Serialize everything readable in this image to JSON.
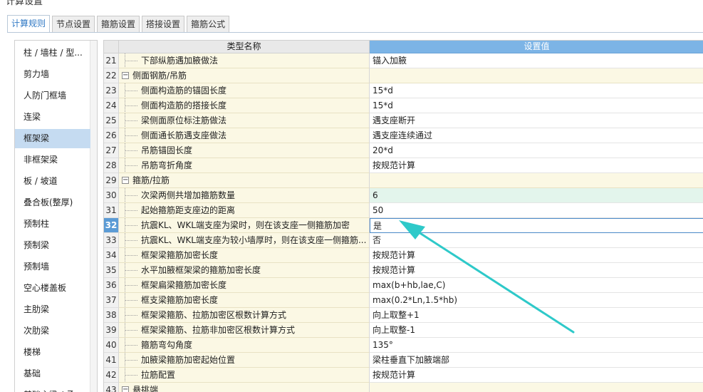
{
  "window": {
    "title": "计算设置"
  },
  "tabs": [
    {
      "label": "计算规则",
      "active": true
    },
    {
      "label": "节点设置",
      "active": false
    },
    {
      "label": "箍筋设置",
      "active": false
    },
    {
      "label": "搭接设置",
      "active": false
    },
    {
      "label": "箍筋公式",
      "active": false
    }
  ],
  "sidebar": {
    "items": [
      {
        "label": "柱 / 墙柱 / 型...",
        "active": false
      },
      {
        "label": "剪力墙",
        "active": false
      },
      {
        "label": "人防门框墙",
        "active": false
      },
      {
        "label": "连梁",
        "active": false
      },
      {
        "label": "框架梁",
        "active": true
      },
      {
        "label": "非框架梁",
        "active": false
      },
      {
        "label": "板 / 坡道",
        "active": false
      },
      {
        "label": "叠合板(整厚)",
        "active": false
      },
      {
        "label": "预制柱",
        "active": false
      },
      {
        "label": "预制梁",
        "active": false
      },
      {
        "label": "预制墙",
        "active": false
      },
      {
        "label": "空心楼盖板",
        "active": false
      },
      {
        "label": "主肋梁",
        "active": false
      },
      {
        "label": "次肋梁",
        "active": false
      },
      {
        "label": "楼梯",
        "active": false
      },
      {
        "label": "基础",
        "active": false
      },
      {
        "label": "基础主梁 / 承...",
        "active": false
      }
    ]
  },
  "table": {
    "headers": {
      "name": "类型名称",
      "value": "设置值"
    },
    "rows": [
      {
        "num": "21",
        "name": "下部纵筋遇加腋做法",
        "value": "锚入加腋",
        "group": false
      },
      {
        "num": "22",
        "name": "侧面钢筋/吊筋",
        "value": "",
        "group": true
      },
      {
        "num": "23",
        "name": "侧面构造筋的锚固长度",
        "value": "15*d",
        "group": false
      },
      {
        "num": "24",
        "name": "侧面构造筋的搭接长度",
        "value": "15*d",
        "group": false
      },
      {
        "num": "25",
        "name": "梁侧面原位标注筋做法",
        "value": "遇支座断开",
        "group": false
      },
      {
        "num": "26",
        "name": "侧面通长筋遇支座做法",
        "value": "遇支座连续通过",
        "group": false
      },
      {
        "num": "27",
        "name": "吊筋锚固长度",
        "value": "20*d",
        "group": false
      },
      {
        "num": "28",
        "name": "吊筋弯折角度",
        "value": "按规范计算",
        "group": false
      },
      {
        "num": "29",
        "name": "箍筋/拉筋",
        "value": "",
        "group": true
      },
      {
        "num": "30",
        "name": "次梁两侧共增加箍筋数量",
        "value": "6",
        "group": false,
        "highlight": "green"
      },
      {
        "num": "31",
        "name": "起始箍筋距支座边的距离",
        "value": "50",
        "group": false
      },
      {
        "num": "32",
        "name": "抗震KL、WKL端支座为梁时，则在该支座一侧箍筋加密",
        "value": "是",
        "group": false,
        "selected": true
      },
      {
        "num": "33",
        "name": "抗震KL、WKL端支座为较小墙厚时，则在该支座一侧箍筋...",
        "value": "否",
        "group": false
      },
      {
        "num": "34",
        "name": "框架梁箍筋加密长度",
        "value": "按规范计算",
        "group": false
      },
      {
        "num": "35",
        "name": "水平加腋框架梁的箍筋加密长度",
        "value": "按规范计算",
        "group": false
      },
      {
        "num": "36",
        "name": "框架扁梁箍筋加密长度",
        "value": "max(b+hb,lae,C)",
        "group": false
      },
      {
        "num": "37",
        "name": "框支梁箍筋加密长度",
        "value": "max(0.2*Ln,1.5*hb)",
        "group": false
      },
      {
        "num": "38",
        "name": "框架梁箍筋、拉筋加密区根数计算方式",
        "value": "向上取整+1",
        "group": false
      },
      {
        "num": "39",
        "name": "框架梁箍筋、拉筋非加密区根数计算方式",
        "value": "向上取整-1",
        "group": false
      },
      {
        "num": "40",
        "name": "箍筋弯勾角度",
        "value": "135°",
        "group": false
      },
      {
        "num": "41",
        "name": "加腋梁箍筋加密起始位置",
        "value": "梁柱垂直下加腋端部",
        "group": false
      },
      {
        "num": "42",
        "name": "拉筋配置",
        "value": "按规范计算",
        "group": false
      },
      {
        "num": "43",
        "name": "悬挑端",
        "value": "",
        "group": true
      }
    ]
  },
  "colors": {
    "accent": "#5b9bd5",
    "header_value_bg": "#7cb4e6",
    "name_cell_bg": "#fbf8e4",
    "annotation_arrow": "#2ec9c9"
  }
}
